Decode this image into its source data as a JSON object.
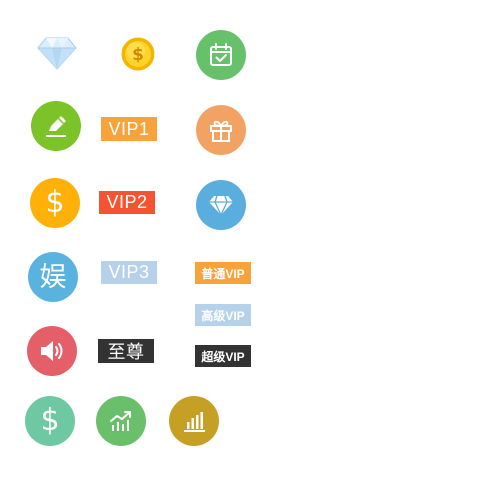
{
  "colors": {
    "edit": "#7cc229",
    "calendar": "#67c06a",
    "gift": "#f2a364",
    "dollar_orange": "#ffb10a",
    "diamond_blue": "#5aaede",
    "entertainment": "#5ab3df",
    "speaker": "#e55f68",
    "dollar_green": "#6ec8a2",
    "growth": "#6abf6b",
    "chart": "#c6a024",
    "vip1": "#f7a23a",
    "vip2": "#f55433",
    "vip3": "#b6d1ea",
    "supreme": "#333333",
    "regular_vip": "#f7a23a",
    "advanced_vip": "#b6d1ea",
    "super_vip": "#333333"
  },
  "icons": {
    "crystal_diamond": "diamond-icon",
    "gold_coin": "gold-coin-icon",
    "calendar": "calendar-check-icon",
    "edit": "pencil-edit-icon",
    "gift": "gift-icon",
    "dollar": "dollar-icon",
    "diamond": "diamond-icon",
    "speaker": "speaker-icon",
    "growth": "growth-chart-icon",
    "bar_chart": "bar-chart-icon"
  },
  "labels": {
    "dollar_sign": "$",
    "entertainment": "娱",
    "vip1": "VIP1",
    "vip2": "VIP2",
    "vip3": "VIP3",
    "supreme": "至尊",
    "regular_vip": "普通VIP",
    "advanced_vip": "高级VIP",
    "super_vip": "超级VIP"
  }
}
